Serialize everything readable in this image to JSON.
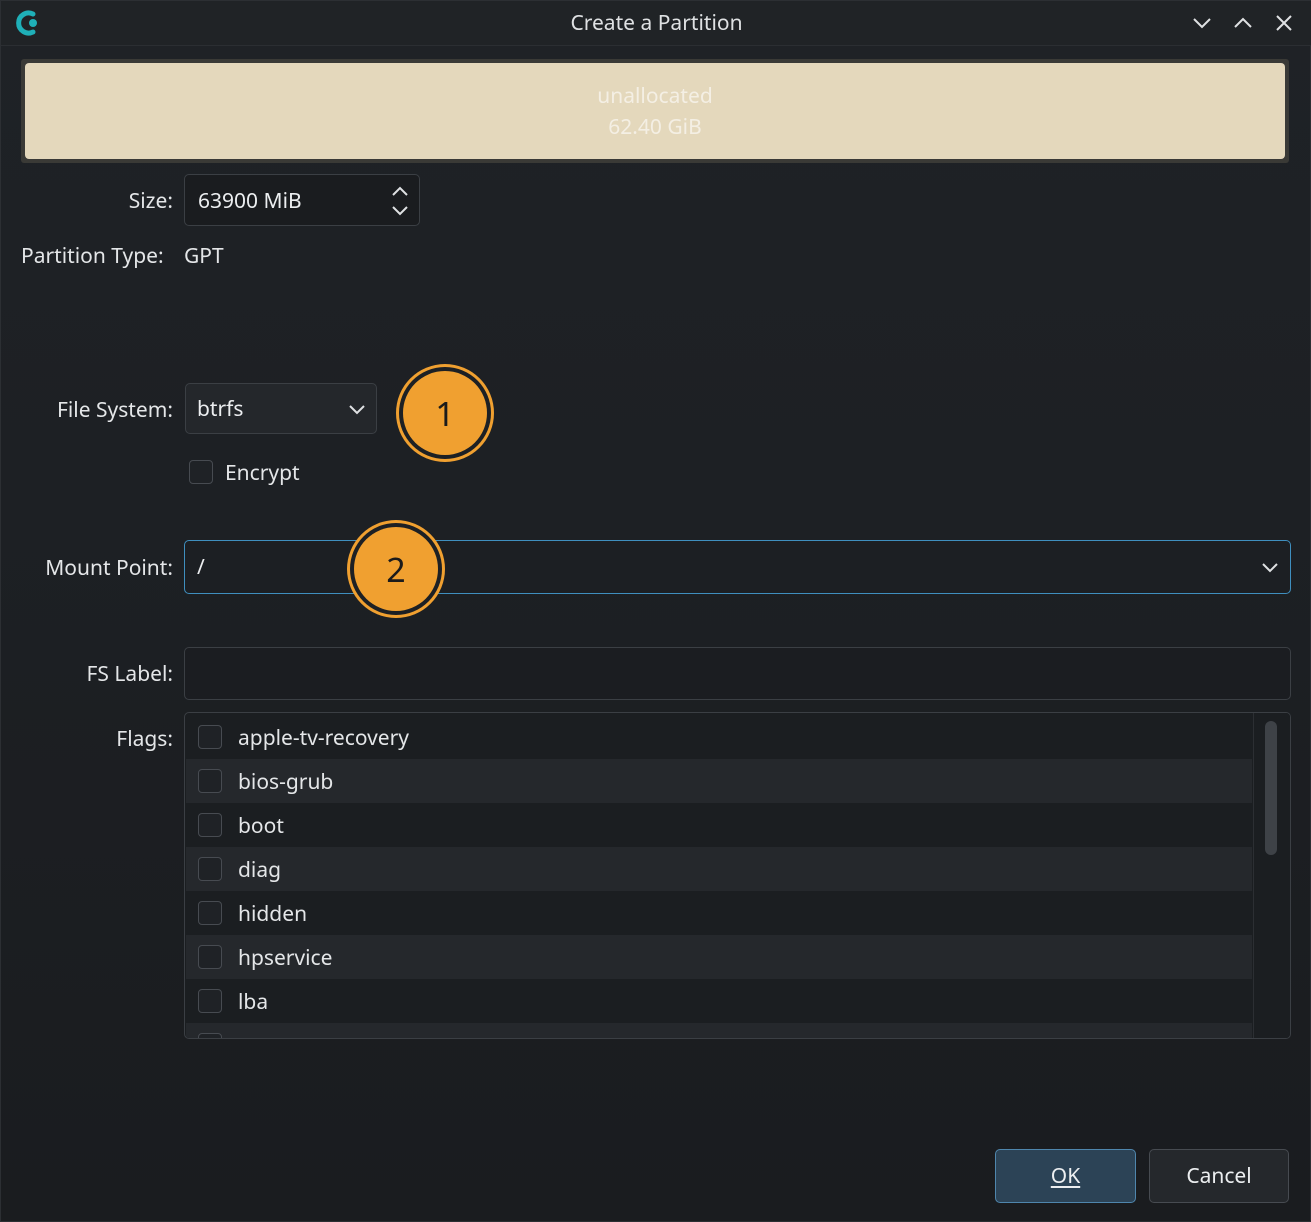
{
  "window": {
    "title": "Create a Partition",
    "minimize_icon": "chevron-down-icon",
    "maximize_icon": "chevron-up-icon",
    "close_icon": "close-icon"
  },
  "partition_bar": {
    "name": "unallocated",
    "size": "62.40 GiB",
    "color": "#e4d8bc"
  },
  "form": {
    "size_label": "Size:",
    "size_value": "63900 MiB",
    "partition_type_label": "Partition Type:",
    "partition_type_value": "GPT",
    "file_system_label": "File System:",
    "file_system_value": "btrfs",
    "encrypt_label": "Encrypt",
    "encrypt_checked": false,
    "mount_point_label": "Mount Point:",
    "mount_point_value": "/",
    "fs_label_label": "FS Label:",
    "fs_label_value": "",
    "flags_label": "Flags:"
  },
  "flags": [
    {
      "label": "apple-tv-recovery",
      "checked": false
    },
    {
      "label": "bios-grub",
      "checked": false
    },
    {
      "label": "boot",
      "checked": false
    },
    {
      "label": "diag",
      "checked": false
    },
    {
      "label": "hidden",
      "checked": false
    },
    {
      "label": "hpservice",
      "checked": false
    },
    {
      "label": "lba",
      "checked": false
    }
  ],
  "annotations": [
    {
      "number": "1"
    },
    {
      "number": "2"
    }
  ],
  "buttons": {
    "ok": "OK",
    "cancel": "Cancel"
  },
  "colors": {
    "accent": "#3f8fbf",
    "badge": "#f0a030",
    "ok_button": "#2c4356"
  }
}
